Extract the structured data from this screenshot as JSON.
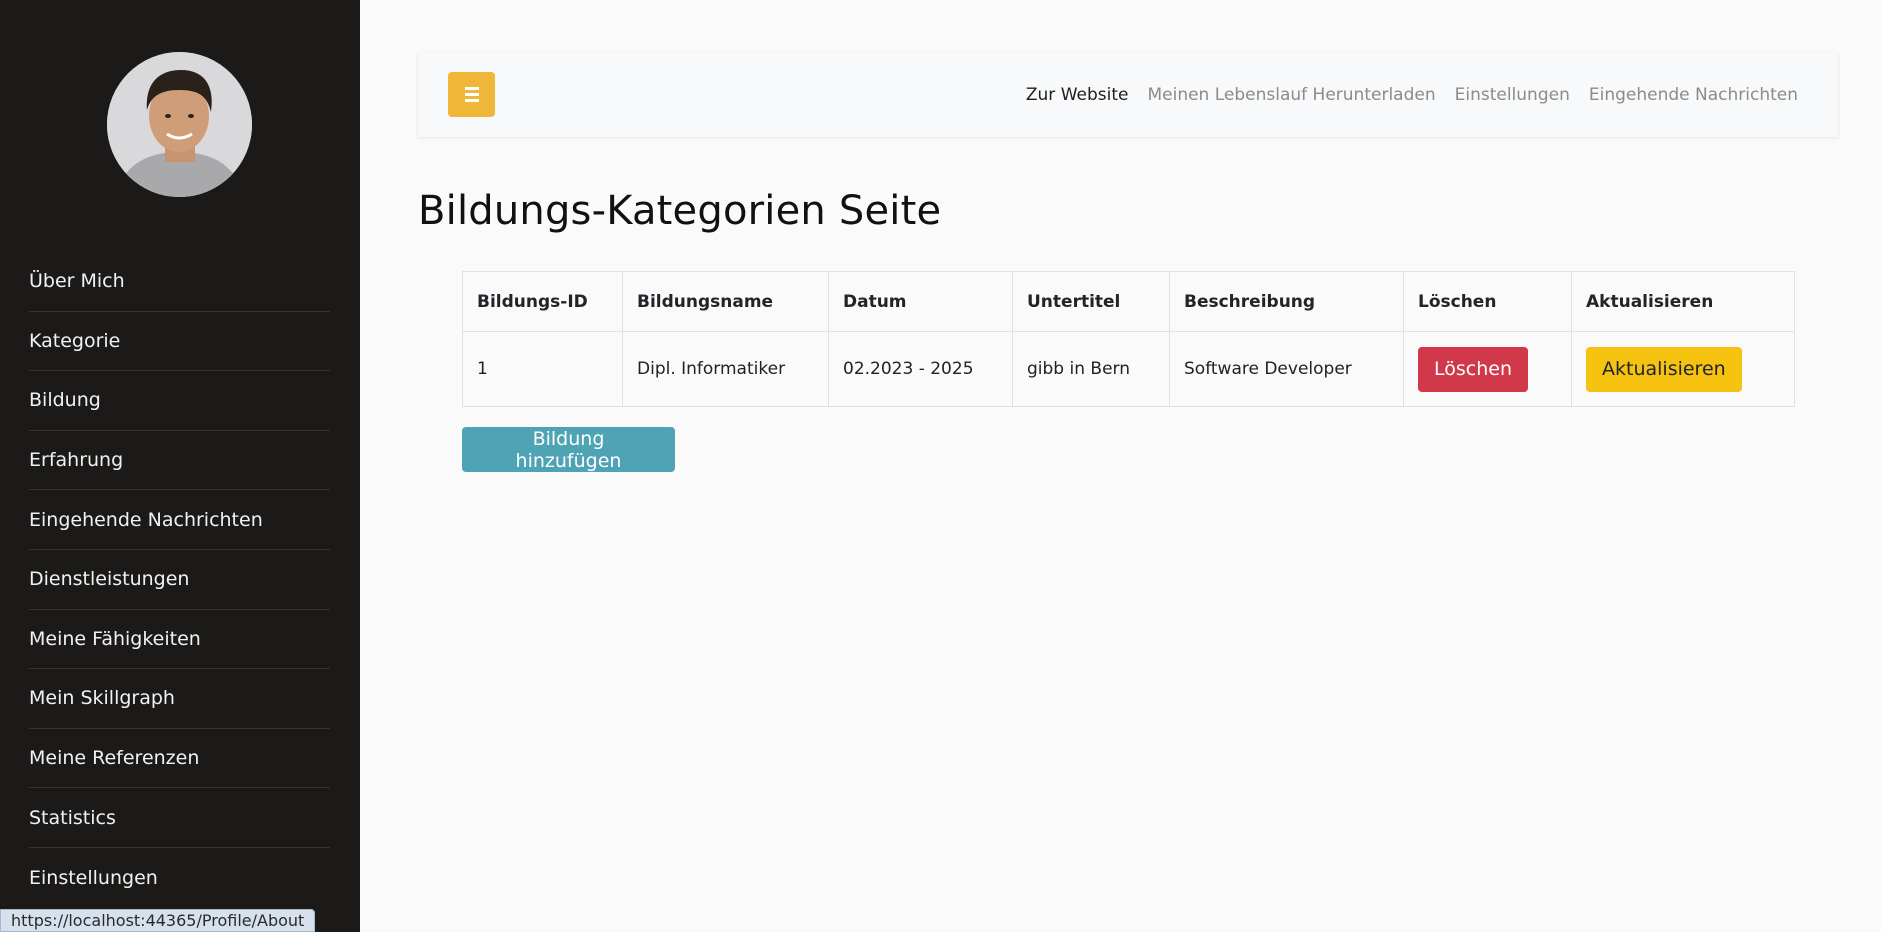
{
  "sidebar": {
    "items": [
      {
        "label": "Über Mich"
      },
      {
        "label": "Kategorie"
      },
      {
        "label": "Bildung"
      },
      {
        "label": "Erfahrung"
      },
      {
        "label": "Eingehende Nachrichten"
      },
      {
        "label": "Dienstleistungen"
      },
      {
        "label": "Meine Fähigkeiten"
      },
      {
        "label": "Mein Skillgraph"
      },
      {
        "label": "Meine Referenzen"
      },
      {
        "label": "Statistics"
      },
      {
        "label": "Einstellungen"
      }
    ]
  },
  "topbar": {
    "menu_icon": "bars-icon",
    "links": [
      {
        "label": "Zur Website"
      },
      {
        "label": "Meinen Lebenslauf Herunterladen"
      },
      {
        "label": "Einstellungen"
      },
      {
        "label": "Eingehende Nachrichten"
      }
    ]
  },
  "main": {
    "title": "Bildungs-Kategorien Seite",
    "table": {
      "headers": [
        "Bildungs-ID",
        "Bildungsname",
        "Datum",
        "Untertitel",
        "Beschreibung",
        "Löschen",
        "Aktualisieren"
      ],
      "rows": [
        {
          "id": "1",
          "name": "Dipl. Informatiker",
          "date": "02.2023 - 2025",
          "subtitle": "gibb in Bern",
          "description": "Software Developer",
          "delete_label": "Löschen",
          "update_label": "Aktualisieren"
        }
      ]
    },
    "add_button_label": "Bildung hinzufügen"
  },
  "status_bar": {
    "url": "https://localhost:44365/Profile/About"
  },
  "colors": {
    "sidebar_bg": "#1c1a19",
    "accent_yellow": "#efb637",
    "danger": "#d1384a",
    "warning": "#f5c30f",
    "info": "#4ea3b5"
  }
}
